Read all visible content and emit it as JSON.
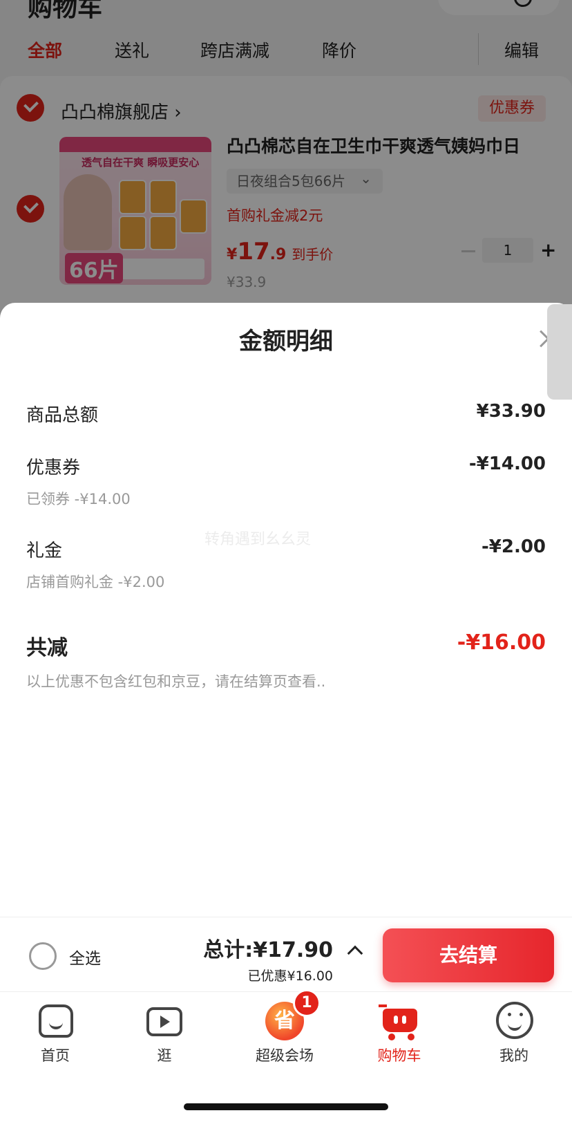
{
  "header": {
    "title": "购物车"
  },
  "tabs": [
    {
      "label": "全部",
      "active": true
    },
    {
      "label": "送礼"
    },
    {
      "label": "跨店满减"
    },
    {
      "label": "降价"
    }
  ],
  "edit_label": "编辑",
  "store": {
    "name": "凸凸棉旗舰店",
    "chevron": "›",
    "coupon_tag": "优惠券"
  },
  "product": {
    "title": "凸凸棉芯自在卫生巾干爽透气姨妈巾日",
    "image_slogan": "透气自在干爽 瞬吸更安心",
    "image_badge": "66片",
    "spec": "日夜组合5包66片",
    "gift": "首购礼金减2元",
    "price_symbol": "¥",
    "price_int": "17",
    "price_dec": ".9",
    "price_label": "到手价",
    "original_price": "¥33.9",
    "quantity": "1",
    "plus": "+"
  },
  "sheet": {
    "title": "金额明细",
    "watermark": "转角遇到幺幺灵",
    "rows": [
      {
        "label": "商品总额",
        "value": "¥33.90"
      },
      {
        "label": "优惠券",
        "value": "-¥14.00",
        "sub": "已领券 -¥14.00"
      },
      {
        "label": "礼金",
        "value": "-¥2.00",
        "sub": "店铺首购礼金 -¥2.00"
      }
    ],
    "total": {
      "label": "共减",
      "value": "-¥16.00"
    },
    "note": "以上优惠不包含红包和京豆，请在结算页查看.."
  },
  "checkout": {
    "select_all": "全选",
    "total": "总计:¥17.90",
    "saved": "已优惠¥16.00",
    "button": "去结算"
  },
  "tabbar": [
    {
      "label": "首页",
      "icon": "home-icon"
    },
    {
      "label": "逛",
      "icon": "video-icon"
    },
    {
      "label": "超级会场",
      "icon": "super-venue-icon",
      "icon_text": "省",
      "badge": "1"
    },
    {
      "label": "购物车",
      "icon": "cart-icon",
      "active": true
    },
    {
      "label": "我的",
      "icon": "smile-icon"
    }
  ],
  "colors": {
    "accent": "#e2231a",
    "muted": "#999999",
    "text": "#222222"
  }
}
